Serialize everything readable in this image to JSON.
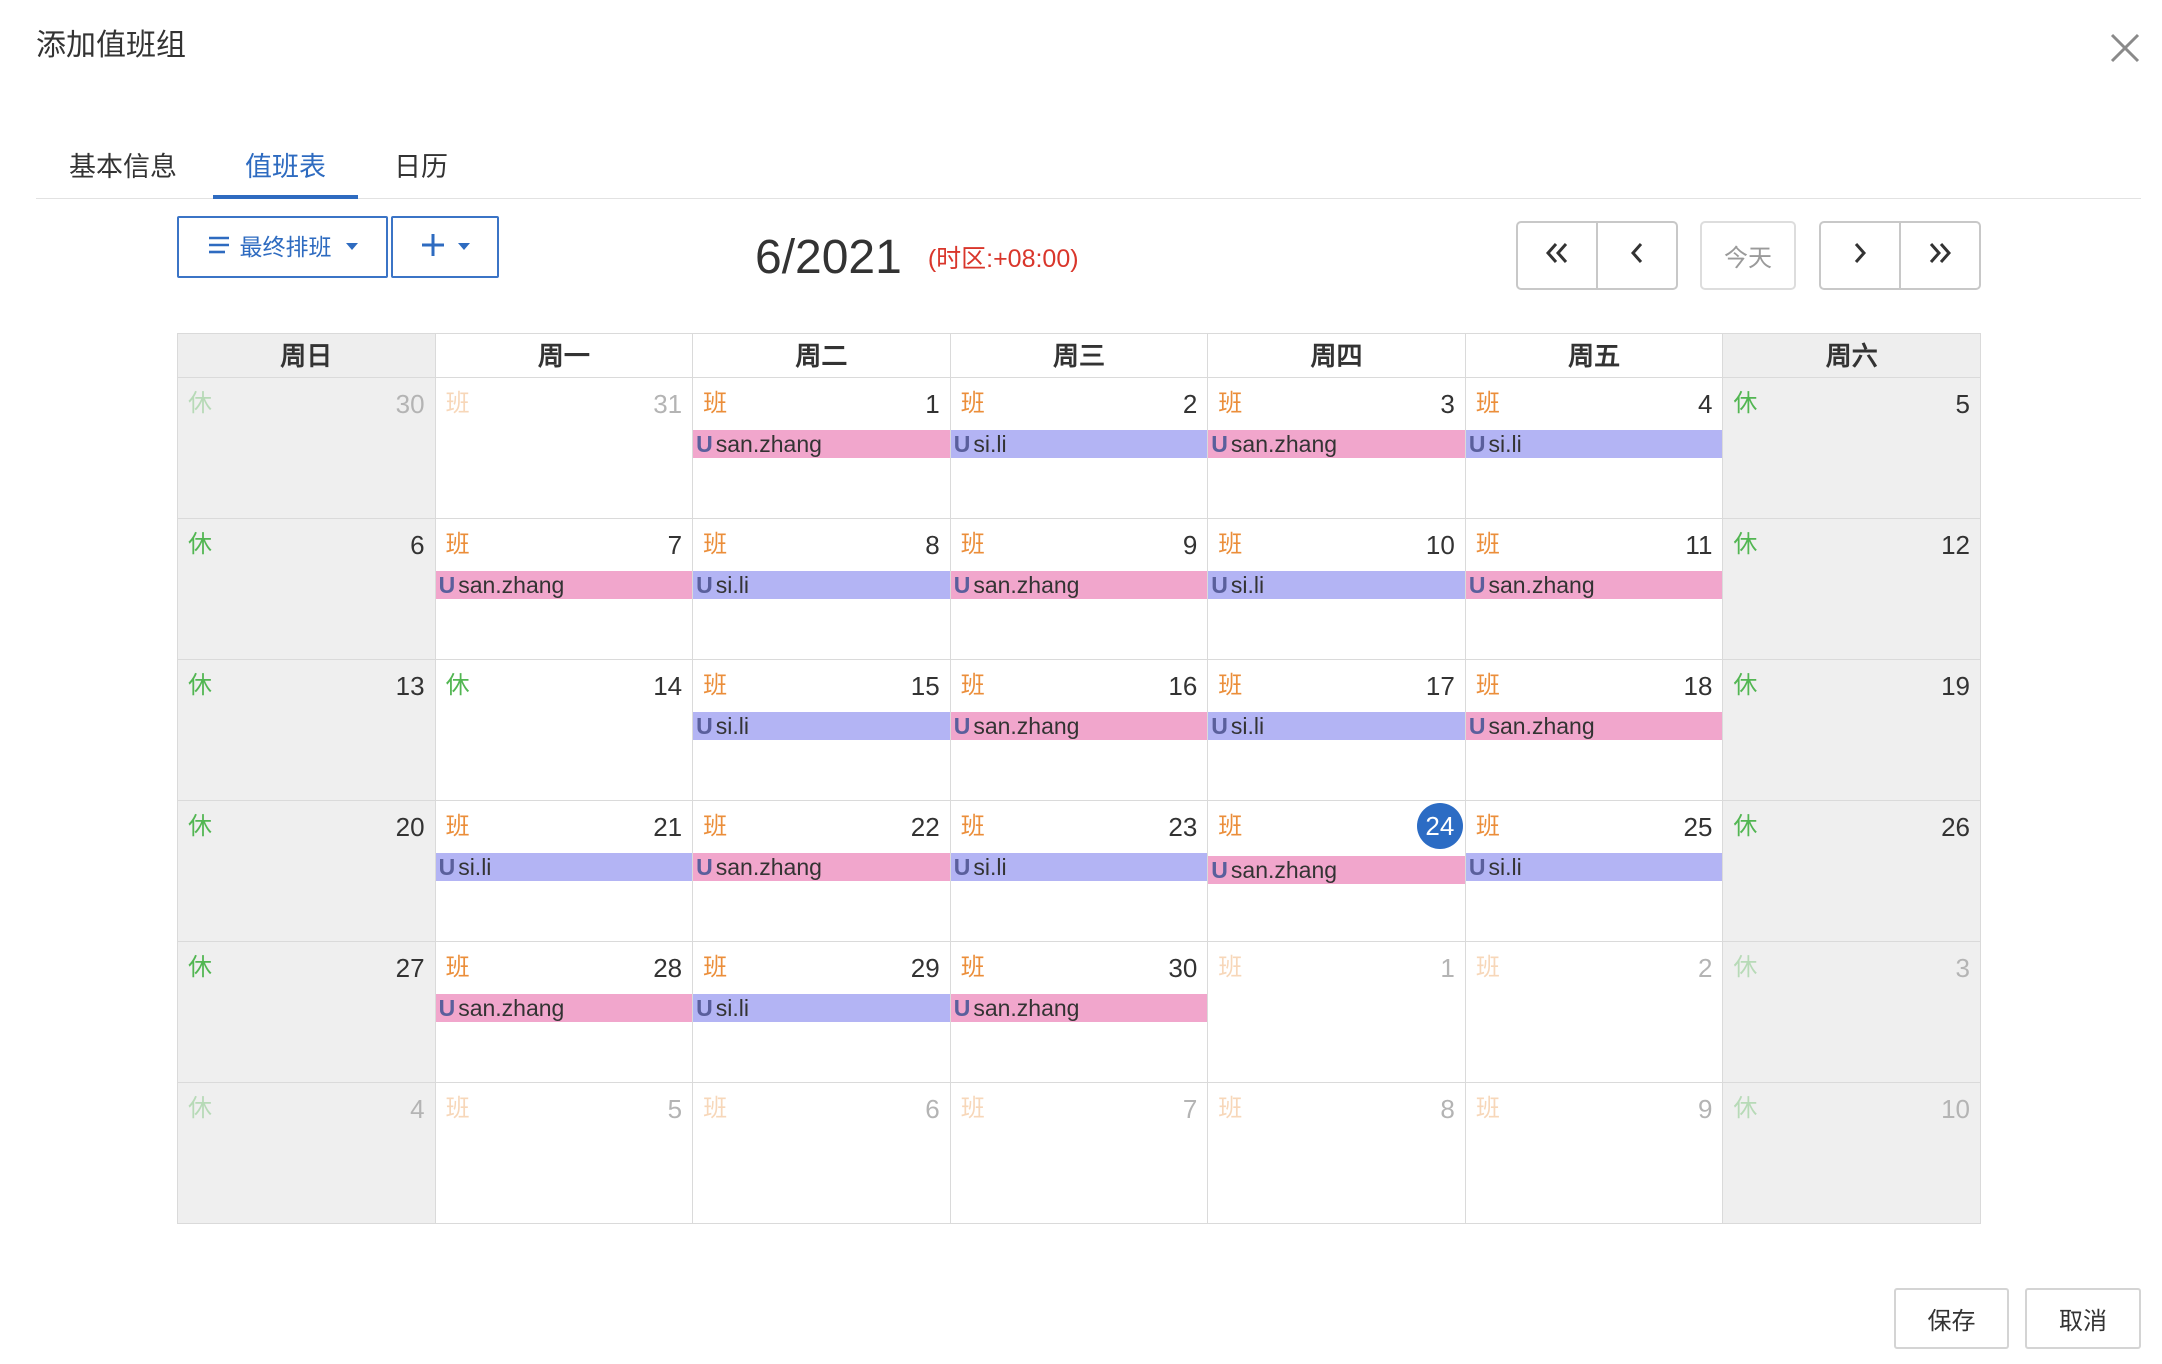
{
  "dialog": {
    "title": "添加值班组",
    "close_icon": "close-icon"
  },
  "tabs": [
    {
      "label": "基本信息",
      "active": false
    },
    {
      "label": "值班表",
      "active": true
    },
    {
      "label": "日历",
      "active": false
    }
  ],
  "toolbar": {
    "schedule_view": {
      "label": "最终排班",
      "icon": "list-icon",
      "caret_icon": "caret-down-icon"
    },
    "add": {
      "icon": "plus-icon",
      "caret_icon": "caret-down-icon"
    }
  },
  "calendar": {
    "title": "6/2021",
    "timezone": "(时区:+08:00)",
    "nav": {
      "first_icon": "double-chevron-left-icon",
      "prev_icon": "chevron-left-icon",
      "today": "今天",
      "next_icon": "chevron-right-icon",
      "last_icon": "double-chevron-right-icon"
    },
    "weekdays": [
      "周日",
      "周一",
      "周二",
      "周三",
      "周四",
      "周五",
      "周六"
    ],
    "weeks": [
      [
        {
          "day": "30",
          "tag": "休",
          "in_month": false,
          "events": []
        },
        {
          "day": "31",
          "tag": "班",
          "in_month": false,
          "events": []
        },
        {
          "day": "1",
          "tag": "班",
          "in_month": true,
          "events": [
            {
              "prefix": "U",
              "user": "san.zhang"
            }
          ]
        },
        {
          "day": "2",
          "tag": "班",
          "in_month": true,
          "events": [
            {
              "prefix": "U",
              "user": "si.li"
            }
          ]
        },
        {
          "day": "3",
          "tag": "班",
          "in_month": true,
          "events": [
            {
              "prefix": "U",
              "user": "san.zhang"
            }
          ]
        },
        {
          "day": "4",
          "tag": "班",
          "in_month": true,
          "events": [
            {
              "prefix": "U",
              "user": "si.li"
            }
          ]
        },
        {
          "day": "5",
          "tag": "休",
          "in_month": true,
          "events": []
        }
      ],
      [
        {
          "day": "6",
          "tag": "休",
          "in_month": true,
          "events": []
        },
        {
          "day": "7",
          "tag": "班",
          "in_month": true,
          "events": [
            {
              "prefix": "U",
              "user": "san.zhang"
            }
          ]
        },
        {
          "day": "8",
          "tag": "班",
          "in_month": true,
          "events": [
            {
              "prefix": "U",
              "user": "si.li"
            }
          ]
        },
        {
          "day": "9",
          "tag": "班",
          "in_month": true,
          "events": [
            {
              "prefix": "U",
              "user": "san.zhang"
            }
          ]
        },
        {
          "day": "10",
          "tag": "班",
          "in_month": true,
          "events": [
            {
              "prefix": "U",
              "user": "si.li"
            }
          ]
        },
        {
          "day": "11",
          "tag": "班",
          "in_month": true,
          "events": [
            {
              "prefix": "U",
              "user": "san.zhang"
            }
          ]
        },
        {
          "day": "12",
          "tag": "休",
          "in_month": true,
          "events": []
        }
      ],
      [
        {
          "day": "13",
          "tag": "休",
          "in_month": true,
          "events": []
        },
        {
          "day": "14",
          "tag": "休",
          "in_month": true,
          "events": []
        },
        {
          "day": "15",
          "tag": "班",
          "in_month": true,
          "events": [
            {
              "prefix": "U",
              "user": "si.li"
            }
          ]
        },
        {
          "day": "16",
          "tag": "班",
          "in_month": true,
          "events": [
            {
              "prefix": "U",
              "user": "san.zhang"
            }
          ]
        },
        {
          "day": "17",
          "tag": "班",
          "in_month": true,
          "events": [
            {
              "prefix": "U",
              "user": "si.li"
            }
          ]
        },
        {
          "day": "18",
          "tag": "班",
          "in_month": true,
          "events": [
            {
              "prefix": "U",
              "user": "san.zhang"
            }
          ]
        },
        {
          "day": "19",
          "tag": "休",
          "in_month": true,
          "events": []
        }
      ],
      [
        {
          "day": "20",
          "tag": "休",
          "in_month": true,
          "events": []
        },
        {
          "day": "21",
          "tag": "班",
          "in_month": true,
          "events": [
            {
              "prefix": "U",
              "user": "si.li"
            }
          ]
        },
        {
          "day": "22",
          "tag": "班",
          "in_month": true,
          "events": [
            {
              "prefix": "U",
              "user": "san.zhang"
            }
          ]
        },
        {
          "day": "23",
          "tag": "班",
          "in_month": true,
          "events": [
            {
              "prefix": "U",
              "user": "si.li"
            }
          ]
        },
        {
          "day": "24",
          "tag": "班",
          "in_month": true,
          "today": true,
          "events": [
            {
              "prefix": "U",
              "user": "san.zhang"
            }
          ]
        },
        {
          "day": "25",
          "tag": "班",
          "in_month": true,
          "events": [
            {
              "prefix": "U",
              "user": "si.li"
            }
          ]
        },
        {
          "day": "26",
          "tag": "休",
          "in_month": true,
          "events": []
        }
      ],
      [
        {
          "day": "27",
          "tag": "休",
          "in_month": true,
          "events": []
        },
        {
          "day": "28",
          "tag": "班",
          "in_month": true,
          "events": [
            {
              "prefix": "U",
              "user": "san.zhang"
            }
          ]
        },
        {
          "day": "29",
          "tag": "班",
          "in_month": true,
          "events": [
            {
              "prefix": "U",
              "user": "si.li"
            }
          ]
        },
        {
          "day": "30",
          "tag": "班",
          "in_month": true,
          "events": [
            {
              "prefix": "U",
              "user": "san.zhang"
            }
          ]
        },
        {
          "day": "1",
          "tag": "班",
          "in_month": false,
          "events": []
        },
        {
          "day": "2",
          "tag": "班",
          "in_month": false,
          "events": []
        },
        {
          "day": "3",
          "tag": "休",
          "in_month": false,
          "events": []
        }
      ],
      [
        {
          "day": "4",
          "tag": "休",
          "in_month": false,
          "events": []
        },
        {
          "day": "5",
          "tag": "班",
          "in_month": false,
          "events": []
        },
        {
          "day": "6",
          "tag": "班",
          "in_month": false,
          "events": []
        },
        {
          "day": "7",
          "tag": "班",
          "in_month": false,
          "events": []
        },
        {
          "day": "8",
          "tag": "班",
          "in_month": false,
          "events": []
        },
        {
          "day": "9",
          "tag": "班",
          "in_month": false,
          "events": []
        },
        {
          "day": "10",
          "tag": "休",
          "in_month": false,
          "events": []
        }
      ]
    ]
  },
  "footer": {
    "save": "保存",
    "cancel": "取消"
  },
  "colors": {
    "accent": "#2e6bc0",
    "timezone": "#d9362b",
    "today_circle": "#2c6cc4",
    "tags": {
      "休": "#52b652",
      "班": "#eb8e3a"
    },
    "users": {
      "san.zhang": "#f1a6cc",
      "si.li": "#b3b4f4"
    }
  }
}
